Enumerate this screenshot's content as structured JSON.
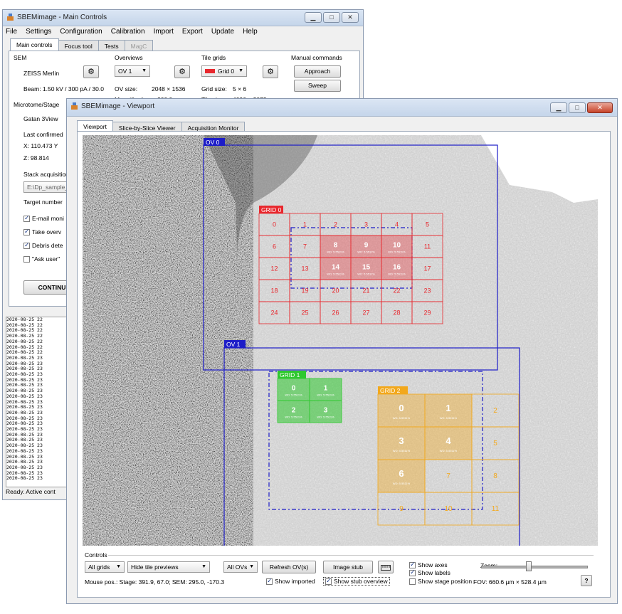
{
  "main_window": {
    "title": "SBEMimage - Main Controls",
    "menu": [
      "File",
      "Settings",
      "Configuration",
      "Calibration",
      "Import",
      "Export",
      "Update",
      "Help"
    ],
    "tabs": [
      {
        "label": "Main controls",
        "active": true
      },
      {
        "label": "Focus tool",
        "active": false
      },
      {
        "label": "Tests",
        "active": false
      },
      {
        "label": "MagC",
        "active": false,
        "disabled": true
      }
    ],
    "sem": {
      "heading": "SEM",
      "model": "ZEISS Merlin",
      "beam": "Beam:  1.50 kV / 300 pA / 30.0"
    },
    "overviews": {
      "heading": "Overviews",
      "selected": "OV 1",
      "size_label": "OV size:",
      "size_value": "2048 × 1536",
      "mag_label": "Magnification:",
      "mag_value": "200.0"
    },
    "tile_grids": {
      "heading": "Tile grids",
      "selected": "Grid 0",
      "size_label": "Grid size:",
      "size_value": "5 × 6",
      "tile_label": "Tile size:",
      "tile_value": "4096 × 3072"
    },
    "manual": {
      "heading": "Manual commands",
      "approach": "Approach",
      "sweep": "Sweep"
    },
    "microtome": {
      "heading": "Microtome/Stage",
      "model": "Gatan 3View",
      "last_confirmed": "Last confirmed",
      "xy": "X: 110.473   Y",
      "z": "Z: 98.814"
    },
    "stack": {
      "heading": "Stack acquisition",
      "path": "E:\\Dp_sample_",
      "target": "Target number"
    },
    "checks": [
      {
        "label": "E-mail moni",
        "checked": true
      },
      {
        "label": "Take overv",
        "checked": true
      },
      {
        "label": "Debris dete",
        "checked": true
      },
      {
        "label": "\"Ask user\"",
        "checked": false
      }
    ],
    "continue": "CONTINU",
    "log": [
      "2020-08-25 22",
      "2020-08-25 22",
      "2020-08-25 22",
      "2020-08-25 22",
      "2020-08-25 22",
      "2020-08-25 22",
      "2020-08-25 22",
      "2020-08-25 23",
      "2020-08-25 23",
      "2020-08-25 23",
      "2020-08-25 23",
      "2020-08-25 23",
      "2020-08-25 23",
      "2020-08-25 23",
      "2020-08-25 23",
      "2020-08-25 23",
      "2020-08-25 23",
      "2020-08-25 23",
      "2020-08-25 23",
      "2020-08-25 23",
      "2020-08-25 23",
      "2020-08-25 23",
      "2020-08-25 23",
      "2020-08-25 23",
      "2020-08-25 23",
      "2020-08-25 23",
      "2020-08-25 23",
      "2020-08-25 23",
      "2020-08-25 23",
      "2020-08-25 23"
    ],
    "status": "Ready. Active cont"
  },
  "viewport_window": {
    "title": "SBEMimage - Viewport",
    "tabs": [
      {
        "label": "Viewport",
        "active": true
      },
      {
        "label": "Slice-by-Slice Viewer",
        "active": false
      },
      {
        "label": "Acquisition Monitor",
        "active": false
      }
    ],
    "overlays": {
      "ov0": "OV 0",
      "ov1": "OV 1",
      "grid0": {
        "label": "GRID 0",
        "tiles": [
          "0",
          "1",
          "2",
          "3",
          "4",
          "5",
          "6",
          "7",
          "8",
          "9",
          "10",
          "11",
          "12",
          "13",
          "14",
          "15",
          "16",
          "17",
          "18",
          "19",
          "20",
          "21",
          "22",
          "23",
          "24",
          "25",
          "26",
          "27",
          "28",
          "29"
        ],
        "active_tiles": [
          "8",
          "9",
          "10",
          "14",
          "15",
          "16"
        ],
        "tile_sub": "WD: 5.5511%"
      },
      "grid1": {
        "label": "GRID 1",
        "tiles": [
          "0",
          "1",
          "2",
          "3"
        ],
        "tile_sub": "WD: 5.5511%"
      },
      "grid2": {
        "label": "GRID 2",
        "tiles": [
          "0",
          "1",
          "2",
          "3",
          "4",
          "5",
          "6",
          "7",
          "8",
          "9",
          "10",
          "11"
        ],
        "active_tiles": [
          "0",
          "1",
          "3",
          "4",
          "6"
        ],
        "tile_sub": "WD: 5.5511%"
      }
    },
    "colors": {
      "ov": "#1d1dc8",
      "grid0": "#e8282e",
      "grid1": "#2ec82e",
      "grid2": "#f2a81c"
    },
    "controls": {
      "heading": "Controls",
      "grids_select": "All grids",
      "previews_select": "Hide tile previews",
      "ovs_select": "All OVs",
      "refresh": "Refresh OV(s)",
      "image_stub": "Image stub",
      "mouse_pos": "Mouse pos.:   Stage: 391.9, 67.0; SEM: 295.0, -170.3",
      "show_imported": "Show imported",
      "show_stub_overview": "Show stub overview",
      "show_axes": "Show axes",
      "show_labels": "Show labels",
      "show_stage_position": "Show stage position",
      "zoom": "Zoom:",
      "zoom_level": 0.45,
      "fov": "FOV:  660.6 µm × 528.4 µm",
      "help": "?"
    }
  }
}
